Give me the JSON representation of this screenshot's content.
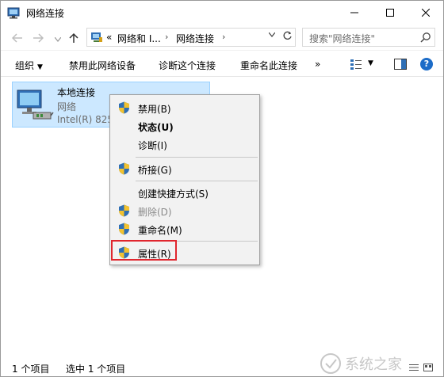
{
  "window": {
    "title": "网络连接"
  },
  "address": {
    "overflow": "«",
    "crumbs": [
      "网络和 I...",
      "网络连接"
    ],
    "search_placeholder": "搜索\"网络连接\""
  },
  "toolbar": {
    "organize": "组织",
    "disable_device": "禁用此网络设备",
    "diagnose": "诊断这个连接",
    "rename": "重命名此连接",
    "more": "»",
    "help": "?"
  },
  "item": {
    "name": "本地连接",
    "status": "网络",
    "adapter": "Intel(R) 825"
  },
  "context_menu": {
    "items": [
      {
        "label": "禁用(B)",
        "shield": true,
        "bold": false,
        "disabled": false
      },
      {
        "label": "状态(U)",
        "shield": false,
        "bold": true,
        "disabled": false
      },
      {
        "label": "诊断(I)",
        "shield": false,
        "bold": false,
        "disabled": false
      },
      {
        "label": "桥接(G)",
        "shield": true,
        "bold": false,
        "disabled": false
      },
      {
        "label": "创建快捷方式(S)",
        "shield": false,
        "bold": false,
        "disabled": false
      },
      {
        "label": "删除(D)",
        "shield": true,
        "bold": false,
        "disabled": true
      },
      {
        "label": "重命名(M)",
        "shield": true,
        "bold": false,
        "disabled": false
      },
      {
        "label": "属性(R)",
        "shield": true,
        "bold": false,
        "disabled": false
      }
    ],
    "highlighted_item": "属性(R)",
    "highlight_color": "#e0262e"
  },
  "statusbar": {
    "count": "1 个项目",
    "selected": "选中 1 个项目"
  },
  "watermark": {
    "text": "系统之家"
  },
  "colors": {
    "selection_bg": "#cce8ff",
    "selection_border": "#99d1ff",
    "menu_bg": "#f2f2f2",
    "help_blue": "#1c6cc8"
  }
}
